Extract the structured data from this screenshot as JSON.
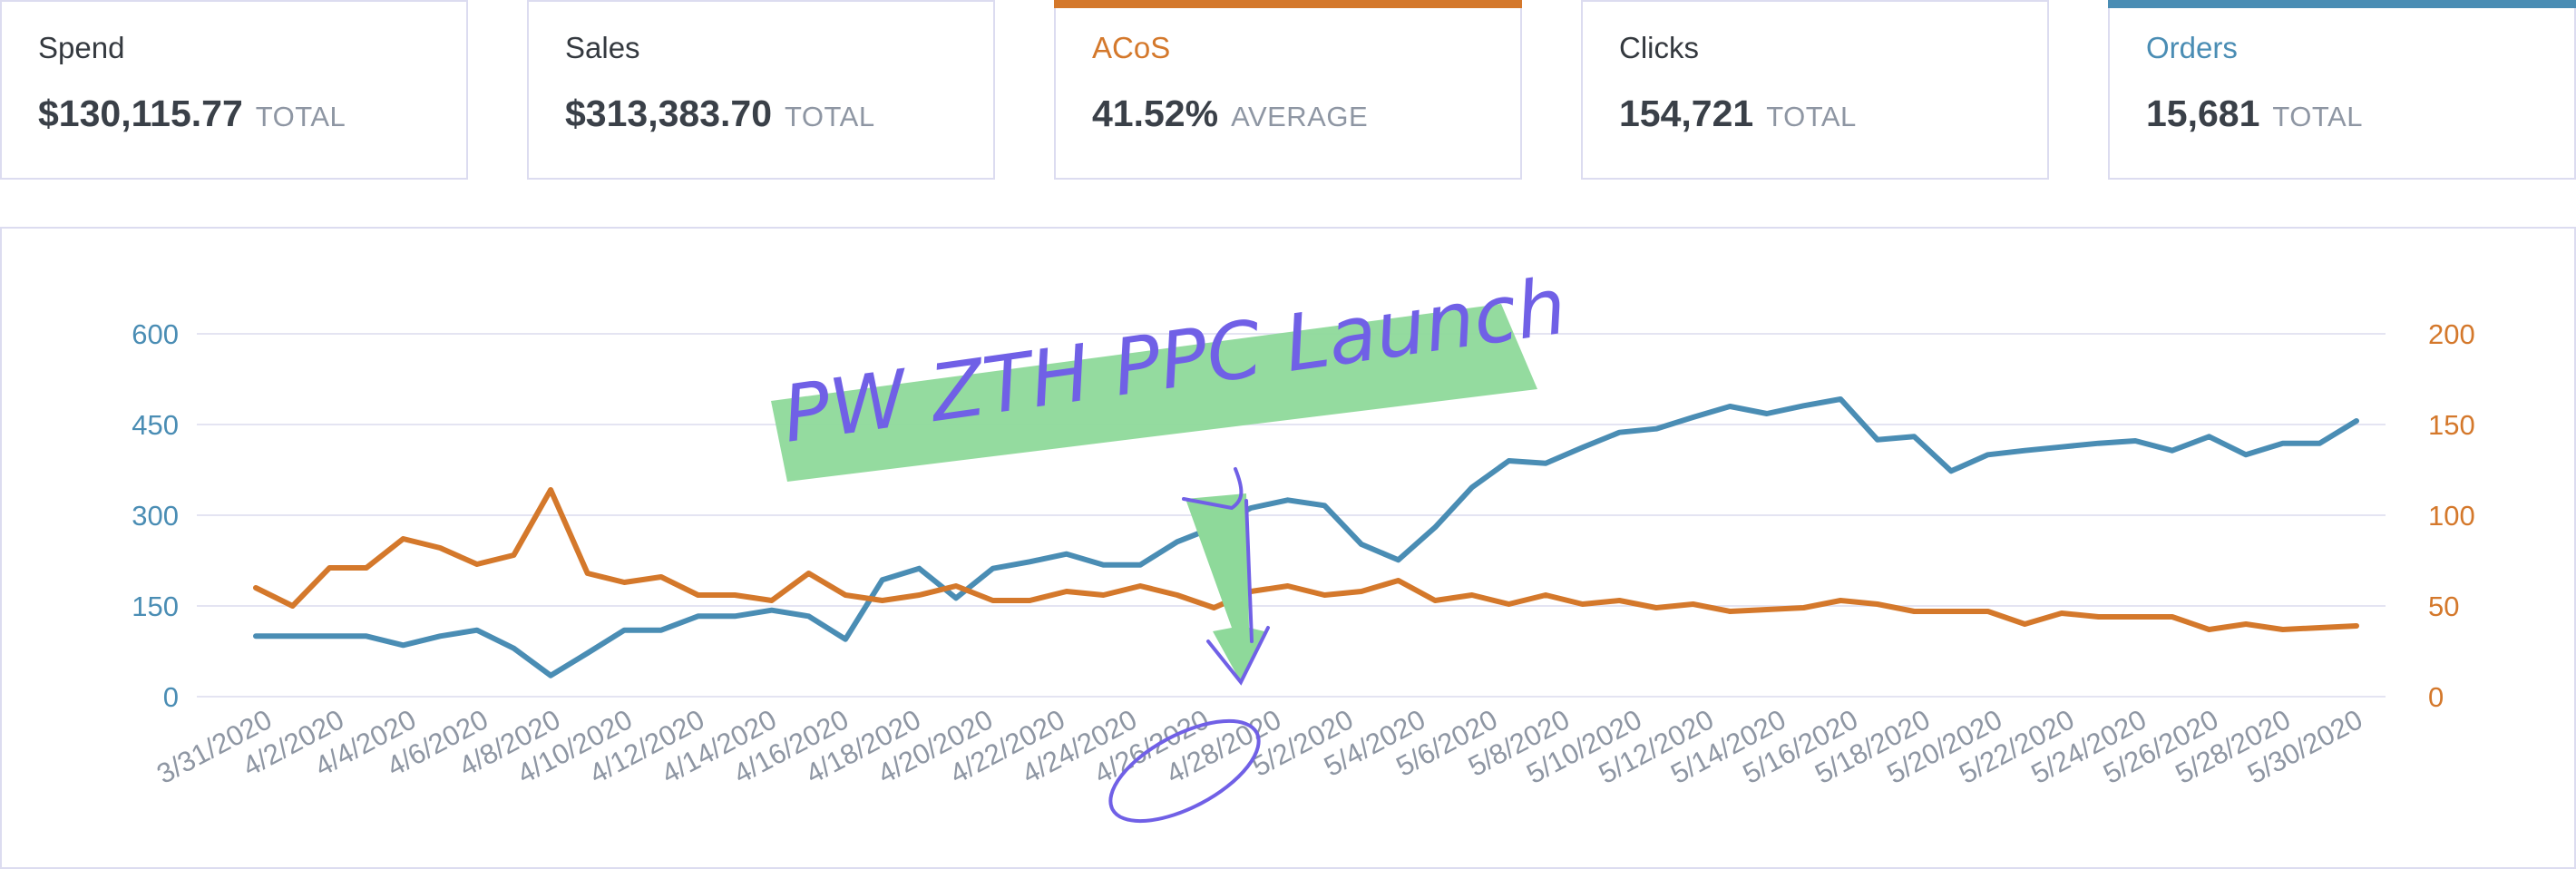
{
  "cards": [
    {
      "label": "Spend",
      "value": "$130,115.77",
      "agg": "TOTAL",
      "accent": ""
    },
    {
      "label": "Sales",
      "value": "$313,383.70",
      "agg": "TOTAL",
      "accent": ""
    },
    {
      "label": "ACoS",
      "value": "41.52%",
      "agg": "AVERAGE",
      "accent": "#d4782b"
    },
    {
      "label": "Clicks",
      "value": "154,721",
      "agg": "TOTAL",
      "accent": ""
    },
    {
      "label": "Orders",
      "value": "15,681",
      "agg": "TOTAL",
      "accent": "#4a8db4"
    }
  ],
  "colors": {
    "orders": "#4a8db4",
    "acos": "#d4782b",
    "label_default": "#34393f",
    "grid": "#e4e4f2"
  },
  "annotation": {
    "text": "PW ZTH PPC Launch",
    "highlight": "#8ed99a",
    "ink": "#7060e6"
  },
  "chart_data": {
    "type": "line",
    "x_labels": [
      "3/31/2020",
      "4/2/2020",
      "4/4/2020",
      "4/6/2020",
      "4/8/2020",
      "4/10/2020",
      "4/12/2020",
      "4/14/2020",
      "4/16/2020",
      "4/18/2020",
      "4/20/2020",
      "4/22/2020",
      "4/24/2020",
      "4/26/2020",
      "4/28/2020",
      "5/2/2020",
      "5/4/2020",
      "5/6/2020",
      "5/8/2020",
      "5/10/2020",
      "5/12/2020",
      "5/14/2020",
      "5/16/2020",
      "5/18/2020",
      "5/20/2020",
      "5/22/2020",
      "5/24/2020",
      "5/26/2020",
      "5/28/2020",
      "5/30/2020"
    ],
    "left_axis": {
      "ticks": [
        "0",
        "150",
        "300",
        "450",
        "600"
      ],
      "ylim": [
        0,
        600
      ]
    },
    "right_axis": {
      "ticks": [
        "0",
        "50",
        "100",
        "150",
        "200"
      ],
      "ylim": [
        0,
        200
      ]
    },
    "grid": true,
    "series": [
      {
        "axis": "left",
        "color": "#4a8db4",
        "values": [
          100,
          100,
          100,
          100,
          85,
          100,
          110,
          80,
          35,
          72,
          110,
          110,
          133,
          133,
          143,
          133,
          95,
          193,
          212,
          163,
          212,
          223,
          236,
          218,
          218,
          256,
          280,
          312,
          325,
          316,
          252,
          226,
          280,
          346,
          390,
          386,
          412,
          437,
          443,
          462,
          480,
          468,
          481,
          492,
          425,
          430,
          373,
          400,
          407,
          413,
          419,
          423,
          407,
          430,
          400,
          419,
          419,
          456
        ]
      },
      {
        "axis": "right",
        "color": "#d4782b",
        "values": [
          60,
          50,
          71,
          71,
          87,
          82,
          73,
          78,
          114,
          68,
          63,
          66,
          56,
          56,
          53,
          68,
          56,
          53,
          56,
          61,
          53,
          53,
          58,
          56,
          61,
          56,
          49,
          58,
          61,
          56,
          58,
          64,
          53,
          56,
          51,
          56,
          51,
          53,
          49,
          51,
          47,
          48,
          49,
          53,
          51,
          47,
          47,
          47,
          40,
          46,
          44,
          44,
          44,
          37,
          40,
          37,
          38,
          39
        ]
      }
    ]
  }
}
